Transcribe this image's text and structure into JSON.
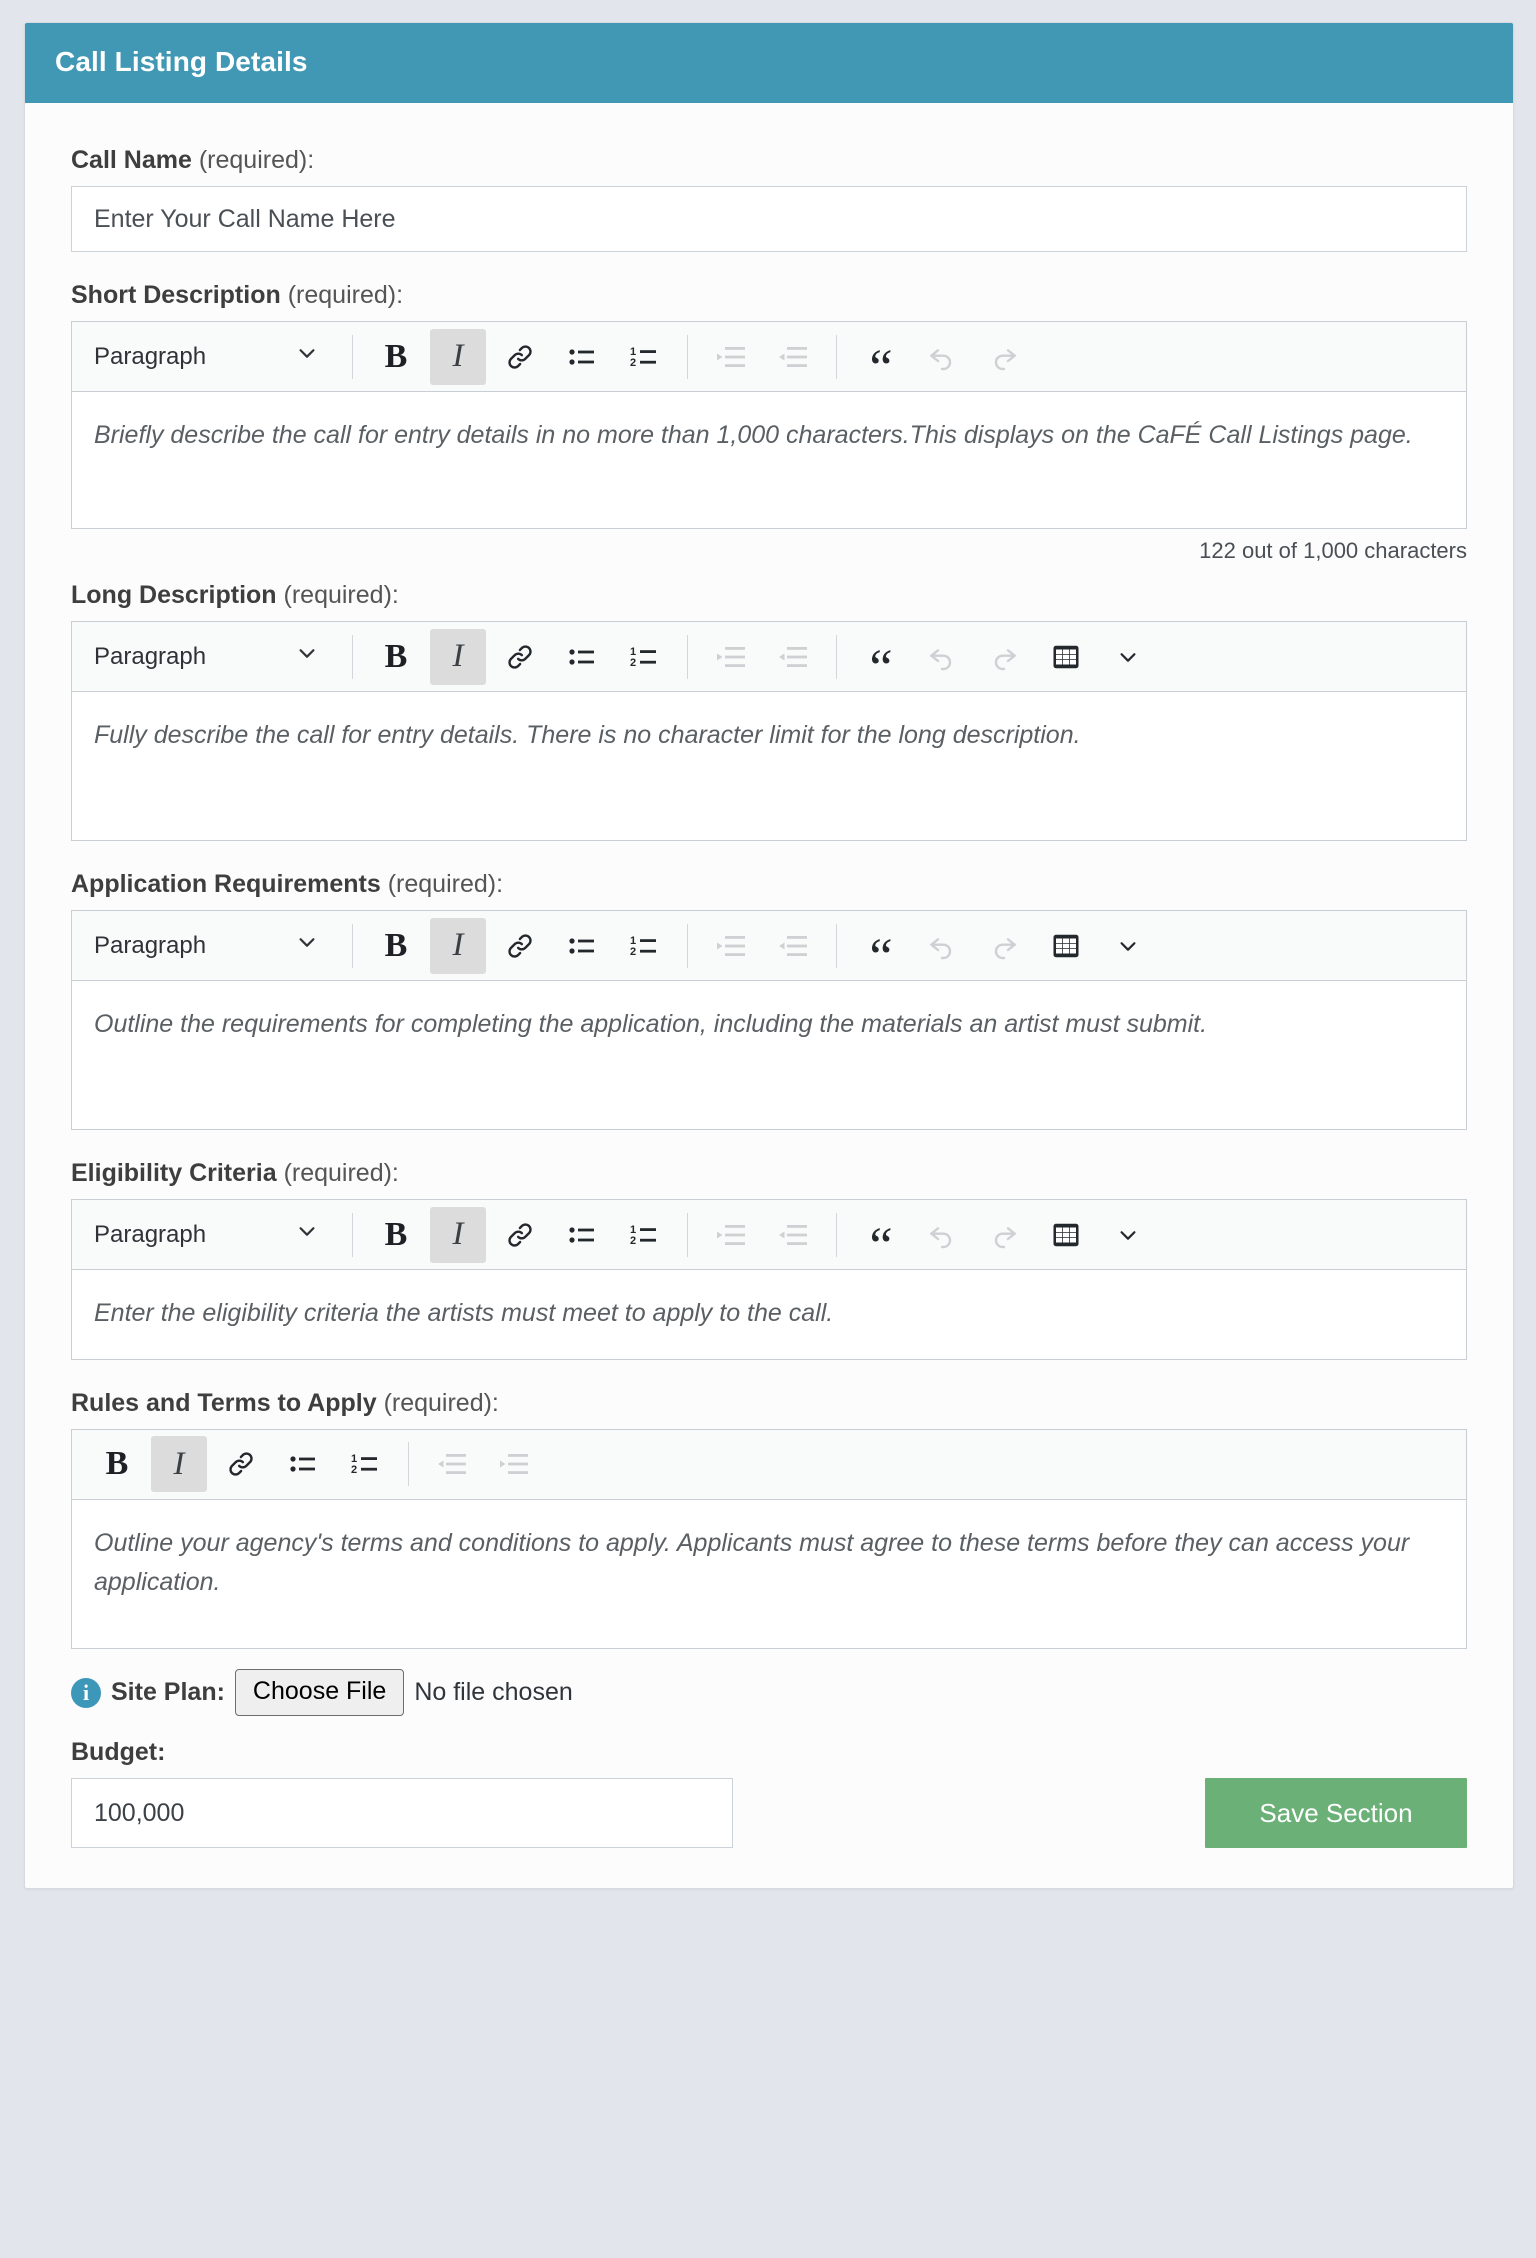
{
  "header": {
    "title": "Call Listing Details"
  },
  "colors": {
    "header_bg": "#4098b4",
    "save_button_bg": "#6ab077",
    "info_icon_bg": "#3d97b8",
    "page_bg": "#e3e5ec"
  },
  "toolbar": {
    "block_format": "Paragraph",
    "bold_label": "B",
    "italic_label": "I",
    "quote_label": "“"
  },
  "fields": {
    "call_name": {
      "label": "Call Name",
      "required_suffix": "(required):",
      "placeholder": "Enter Your Call Name Here",
      "value": ""
    },
    "short_description": {
      "label": "Short Description",
      "required_suffix": "(required):",
      "content": "Briefly describe the call for entry details in no more than 1,000 characters.This displays on the CaFÉ Call Listings page.",
      "char_count": "122 out of 1,000 characters"
    },
    "long_description": {
      "label": "Long Description",
      "required_suffix": "(required):",
      "content": "Fully describe the call for entry details. There is no character limit for the long description."
    },
    "application_requirements": {
      "label": "Application Requirements",
      "required_suffix": "(required):",
      "content": "Outline the requirements for completing the application, including the materials an artist must submit."
    },
    "eligibility_criteria": {
      "label": "Eligibility Criteria",
      "required_suffix": "(required):",
      "content": "Enter the eligibility criteria the artists must meet to apply to the call."
    },
    "rules_and_terms": {
      "label": "Rules and Terms to Apply",
      "required_suffix": "(required):",
      "content": "Outline your agency's terms and conditions to apply. Applicants must agree to these terms before they can access your application."
    },
    "site_plan": {
      "label": "Site Plan:",
      "choose_file_label": "Choose File",
      "no_file_text": "No file chosen"
    },
    "budget": {
      "label": "Budget:",
      "value": "100,000"
    }
  },
  "actions": {
    "save_section_label": "Save Section"
  },
  "icons": {
    "chevron_down": "chevron-down-icon",
    "link": "link-icon",
    "bullet_list": "bullet-list-icon",
    "numbered_list": "numbered-list-icon",
    "indent": "indent-icon",
    "outdent": "outdent-icon",
    "blockquote": "blockquote-icon",
    "undo": "undo-icon",
    "redo": "redo-icon",
    "table": "table-icon",
    "info": "info-icon"
  }
}
